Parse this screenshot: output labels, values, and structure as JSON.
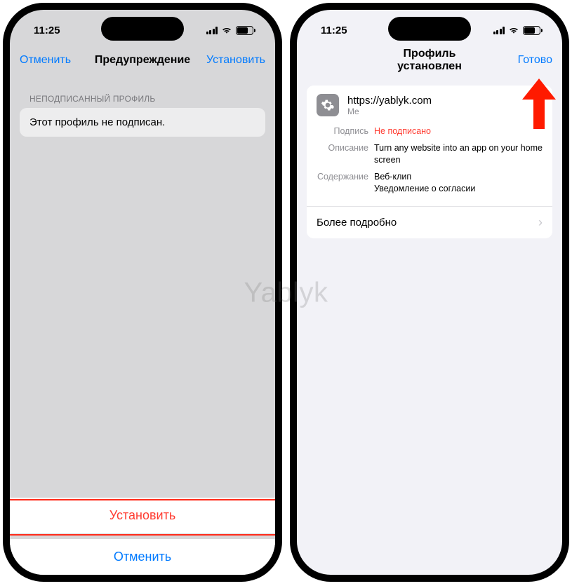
{
  "status": {
    "time": "11:25",
    "battery_percent": "69"
  },
  "left_phone": {
    "nav": {
      "cancel": "Отменить",
      "title": "Предупреждение",
      "install": "Установить"
    },
    "section_header": "НЕПОДПИСАННЫЙ ПРОФИЛЬ",
    "unsigned_message": "Этот профиль не подписан.",
    "sheet": {
      "install": "Установить",
      "cancel": "Отменить"
    }
  },
  "right_phone": {
    "nav": {
      "title": "Профиль установлен",
      "done": "Готово"
    },
    "profile": {
      "url": "https://yablyk.com",
      "sub": "Me",
      "signature_label": "Подпись",
      "signature_value": "Не подписано",
      "description_label": "Описание",
      "description_value": "Turn any website into an app on your home screen",
      "contents_label": "Содержание",
      "contents_value1": "Веб-клип",
      "contents_value2": "Уведомление о согласии",
      "more": "Более подробно"
    }
  },
  "watermark": "Yablyk"
}
